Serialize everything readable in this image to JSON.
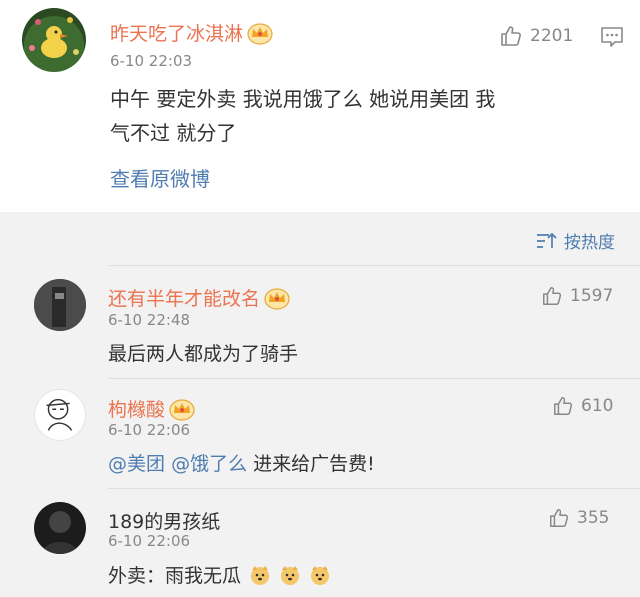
{
  "main_comment": {
    "username": "昨天吃了冰淇淋",
    "time": "6-10 22:03",
    "likes": "2201",
    "text": "中午 要定外卖 我说用饿了么  她说用美团 我气不过 就分了",
    "view_original": "查看原微博"
  },
  "sort": {
    "label": "按热度"
  },
  "replies": [
    {
      "username": "还有半年才能改名",
      "time": "6-10 22:48",
      "likes": "1597",
      "text": "最后两人都成为了骑手"
    },
    {
      "username": "枸橼酸",
      "time": "6-10 22:06",
      "likes": "610",
      "mention1": "@美团",
      "mention2": "@饿了么",
      "text_rest": " 进来给广告费!"
    },
    {
      "username": "189的男孩纸",
      "time": "6-10 22:06",
      "likes": "355",
      "text": "外卖：雨我无瓜"
    }
  ],
  "colors": {
    "username": "#eb7350",
    "link": "#507daf",
    "meta": "#888888",
    "background": "#f2f2f2"
  },
  "icons": {
    "like": "thumbs-up-icon",
    "comment": "comment-icon",
    "sort": "sort-icon",
    "vip": "crown-icon",
    "emoji": "doge-emoji-icon"
  }
}
